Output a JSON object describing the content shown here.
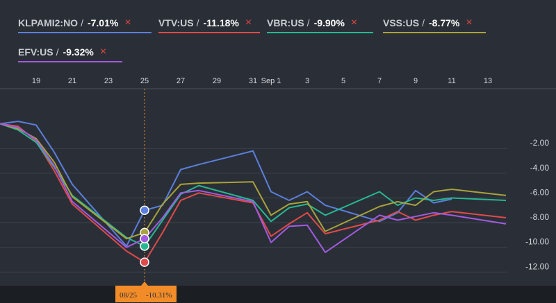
{
  "legend": [
    {
      "symbol": "KLPAMI2:NO",
      "change": "-7.01%",
      "color": "#5b7fdc"
    },
    {
      "symbol": "VTV:US",
      "change": "-11.18%",
      "color": "#e04a4a"
    },
    {
      "symbol": "VBR:US",
      "change": "-9.90%",
      "color": "#26b791"
    },
    {
      "symbol": "VSS:US",
      "change": "-8.77%",
      "color": "#a9a33b"
    },
    {
      "symbol": "EFV:US",
      "change": "-9.32%",
      "color": "#a25be0"
    }
  ],
  "legend_separator": "/",
  "remove_glyph": "×",
  "crosshair": {
    "date": "08/25",
    "value": "-10.31%",
    "color": "#f28c28"
  },
  "chart_data": {
    "type": "line",
    "x_tick_labels": [
      "19",
      "21",
      "23",
      "25",
      "27",
      "29",
      "31",
      "Sep 1",
      "3",
      "5",
      "7",
      "9",
      "11",
      "13"
    ],
    "y_ticks": [
      -2,
      -4,
      -6,
      -8,
      -10,
      -12
    ],
    "y_tick_labels": [
      "-2.00",
      "-4.00",
      "-6.00",
      "-8.00",
      "-10.00",
      "-12.00"
    ],
    "ylim": [
      -13.1,
      1.6
    ],
    "grid": true,
    "x_dates": [
      "Aug 17",
      "Aug 18",
      "Aug 19",
      "Aug 20",
      "Aug 21",
      "Aug 24",
      "Aug 25",
      "Aug 26",
      "Aug 27",
      "Aug 28",
      "Aug 31",
      "Sep 1",
      "Sep 2",
      "Sep 3",
      "Sep 4",
      "Sep 7",
      "Sep 8",
      "Sep 9",
      "Sep 10",
      "Sep 11",
      "Sep 14"
    ],
    "x_index": [
      0,
      1,
      2,
      3,
      4,
      7,
      8,
      9,
      10,
      11,
      14,
      15,
      16,
      17,
      18,
      21,
      22,
      23,
      24,
      25,
      28
    ],
    "series": [
      {
        "name": "KLPAMI2:NO",
        "color": "#5b7fdc",
        "values": [
          0,
          0.2,
          -0.1,
          -2.3,
          -4.9,
          -9.9,
          -7.0,
          -6.6,
          -3.7,
          -3.3,
          -2.2,
          -5.5,
          -6.2,
          -5.5,
          -6.6,
          -7.9,
          -7.2,
          -5.4,
          -6.4,
          -6.1,
          null
        ]
      },
      {
        "name": "VTV:US",
        "color": "#e04a4a",
        "values": [
          0,
          -0.2,
          -1.4,
          -3.8,
          -6.5,
          -10.3,
          -11.2,
          -8.8,
          -6.2,
          -5.6,
          -6.4,
          -9.1,
          -8.1,
          -7.2,
          -8.9,
          -7.8,
          -7.1,
          -7.8,
          -7.4,
          -7.1,
          -7.6
        ]
      },
      {
        "name": "VBR:US",
        "color": "#26b791",
        "values": [
          0,
          -0.5,
          -1.5,
          -3.5,
          -5.8,
          -9.2,
          -9.9,
          -7.8,
          -5.7,
          -5.0,
          -6.2,
          -7.9,
          -6.8,
          -6.5,
          -7.4,
          -5.5,
          -6.6,
          -6.0,
          -6.2,
          -6.0,
          -6.2
        ]
      },
      {
        "name": "VSS:US",
        "color": "#a9a33b",
        "values": [
          0,
          -0.4,
          -1.2,
          -3.1,
          -5.9,
          -9.3,
          -8.8,
          -6.5,
          -4.9,
          -4.8,
          -4.7,
          -7.4,
          -6.5,
          -6.3,
          -8.7,
          -6.7,
          -6.3,
          -6.6,
          -5.5,
          -5.3,
          -5.8
        ]
      },
      {
        "name": "EFV:US",
        "color": "#a25be0",
        "values": [
          0,
          -0.3,
          -1.3,
          -3.4,
          -6.3,
          -10.0,
          -9.3,
          -7.6,
          -5.6,
          -5.4,
          -6.3,
          -9.6,
          -8.3,
          -8.2,
          -10.4,
          -7.4,
          -7.8,
          -7.5,
          -7.2,
          -7.4,
          -8.1
        ]
      }
    ]
  }
}
